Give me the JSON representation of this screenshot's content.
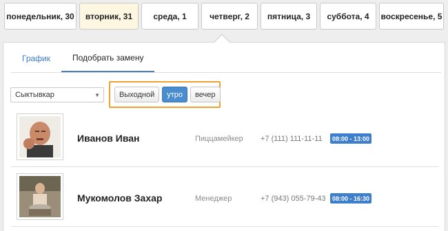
{
  "days": [
    {
      "label": "понедельник, 30",
      "active": false
    },
    {
      "label": "вторник, 31",
      "active": true
    },
    {
      "label": "среда, 1",
      "active": false
    },
    {
      "label": "четверг, 2",
      "active": false
    },
    {
      "label": "пятница, 3",
      "active": false
    },
    {
      "label": "суббота, 4",
      "active": false
    },
    {
      "label": "воскресенье, 5",
      "active": false
    }
  ],
  "subtabs": {
    "schedule": "График",
    "replacement": "Подобрать замену"
  },
  "filters": {
    "city": "Сыктывкар",
    "shifts": {
      "day_off": "Выходной",
      "morning": "утро",
      "evening": "вечер",
      "selected": "утро"
    }
  },
  "employees": [
    {
      "name": "Иванов Иван",
      "role": "Пиццамейкер",
      "phone": "+7 (111) 111-11-11",
      "hours": "08:00 - 13:00"
    },
    {
      "name": "Мукомолов Захар",
      "role": "Менеджер",
      "phone": "+7 (943) 055-79-43",
      "hours": "08:00 - 16:30"
    }
  ],
  "colors": {
    "accent": "#3d7fcc",
    "highlight_border": "#f0a030",
    "active_day_bg": "#fdf6e1"
  }
}
